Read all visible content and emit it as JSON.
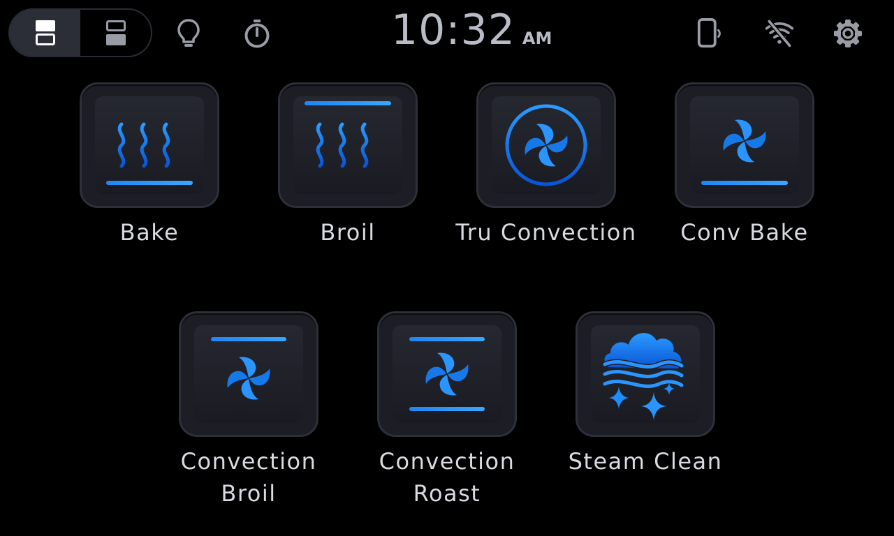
{
  "status_bar": {
    "oven_toggle": {
      "upper_oven": "upper-oven-icon",
      "lower_oven": "lower-oven-icon"
    },
    "icons": [
      "light-bulb-icon",
      "timer-icon",
      "remote-enable-icon",
      "wifi-off-icon",
      "gear-icon"
    ],
    "clock": {
      "time": "10:32",
      "ampm": "AM"
    }
  },
  "modes": [
    {
      "id": "bake",
      "label_lines": [
        "Bake"
      ],
      "icon": "bake-icon"
    },
    {
      "id": "broil",
      "label_lines": [
        "Broil"
      ],
      "icon": "broil-icon"
    },
    {
      "id": "tru-convection",
      "label_lines": [
        "Tru Convection"
      ],
      "icon": "tru-convection-icon"
    },
    {
      "id": "conv-bake",
      "label_lines": [
        "Conv Bake"
      ],
      "icon": "conv-bake-icon"
    },
    {
      "id": "convection-broil",
      "label_lines": [
        "Convection",
        "Broil"
      ],
      "icon": "convection-broil-icon"
    },
    {
      "id": "convection-roast",
      "label_lines": [
        "Convection",
        "Roast"
      ],
      "icon": "convection-roast-icon"
    },
    {
      "id": "steam-clean",
      "label_lines": [
        "Steam Clean"
      ],
      "icon": "steam-clean-icon"
    }
  ],
  "colors": {
    "accent": "#1c8dff",
    "accent_dark": "#0a55d6",
    "tile_bg": "#1d1e25",
    "tile_border": "#2e3039",
    "text": "#d9dbe1",
    "icon_gray": "#9a9ca5"
  }
}
